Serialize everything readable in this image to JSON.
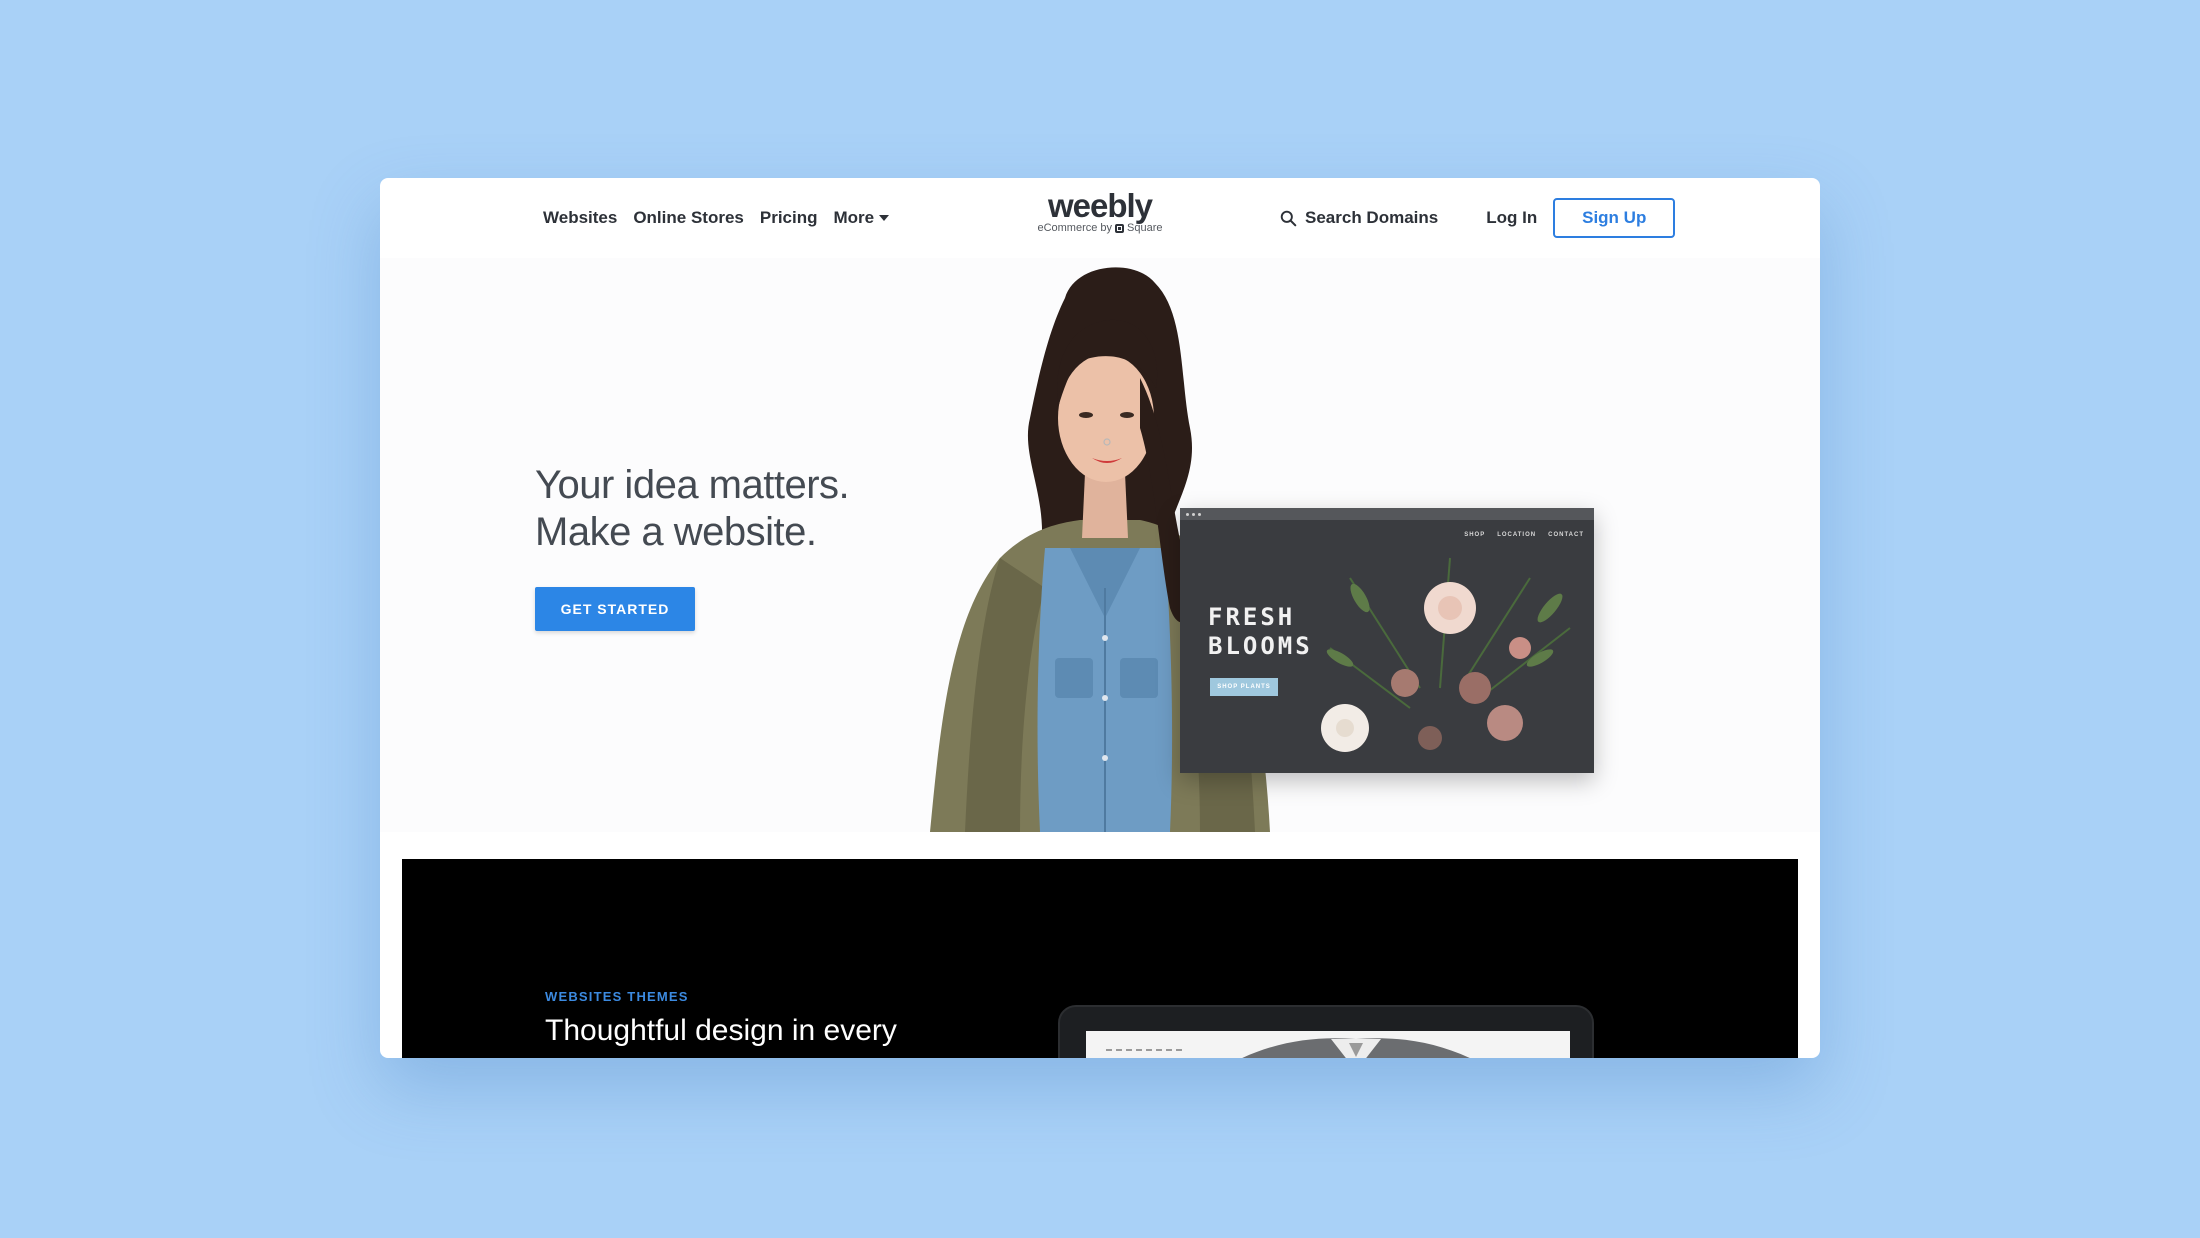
{
  "nav": {
    "links": [
      "Websites",
      "Online Stores",
      "Pricing",
      "More"
    ],
    "logo": {
      "word": "weebly",
      "sub_prefix": "eCommerce by",
      "sub_brand": "Square"
    },
    "search_domains": "Search Domains",
    "login": "Log In",
    "signup": "Sign Up"
  },
  "hero": {
    "headline_line1": "Your idea matters.",
    "headline_line2": "Make a website.",
    "cta": "GET STARTED",
    "mockup": {
      "nav": [
        "SHOP",
        "LOCATION",
        "CONTACT"
      ],
      "title_line1": "FRESH",
      "title_line2": "BLOOMS",
      "button": "SHOP PLANTS"
    }
  },
  "themes": {
    "eyebrow": "WEBSITES THEMES",
    "title": "Thoughtful design in every"
  },
  "colors": {
    "page_background": "#a9d1f7",
    "accent_blue": "#2c86e6",
    "text_dark": "#2d3138",
    "dark_section": "#000000"
  },
  "icons": [
    "search-icon",
    "chevron-down-icon",
    "square-logo-icon"
  ]
}
